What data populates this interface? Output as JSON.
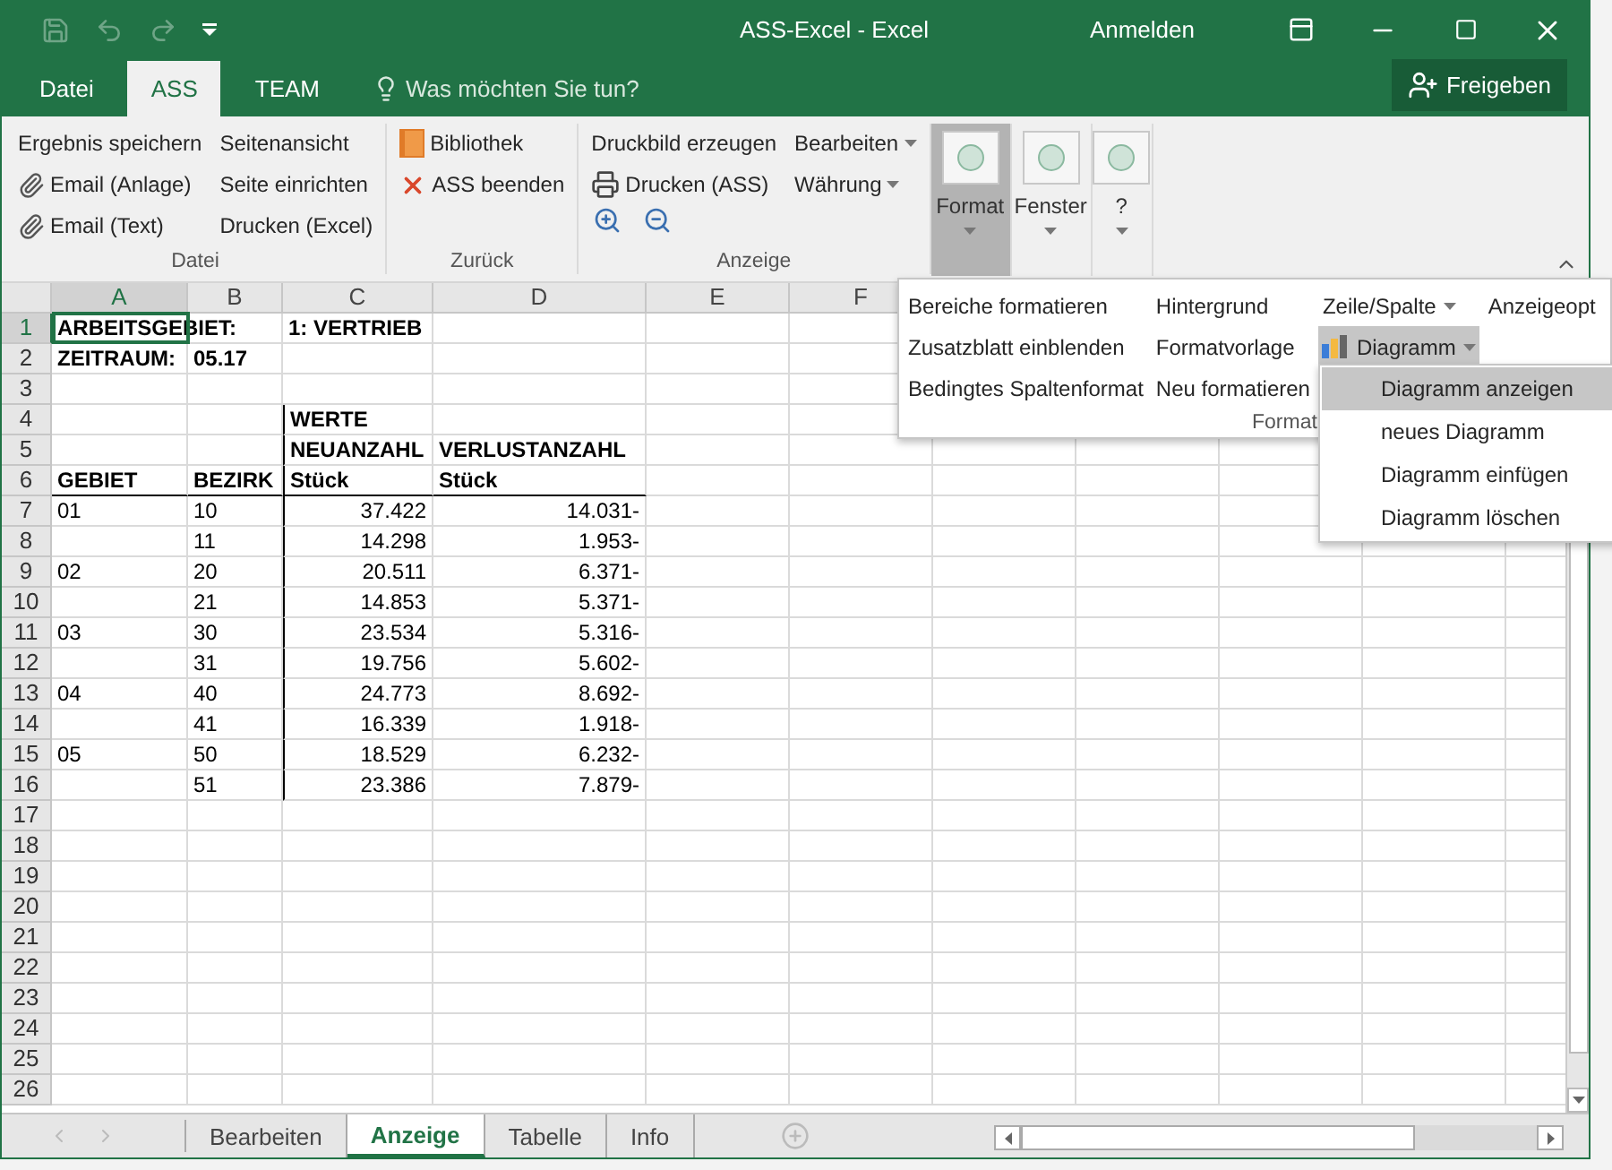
{
  "window": {
    "title": "ASS-Excel  -  Excel",
    "sign_in": "Anmelden"
  },
  "ribbon_tabs": [
    {
      "label": "Datei",
      "selected": false
    },
    {
      "label": "ASS",
      "selected": true
    },
    {
      "label": "TEAM",
      "selected": false
    }
  ],
  "tell_me": {
    "placeholder": "Was möchten Sie tun?"
  },
  "share_button": "Freigeben",
  "ribbon_groups": [
    {
      "label": "Datei",
      "columns": [
        [
          {
            "kind": "plain",
            "label": "Ergebnis speichern"
          },
          {
            "kind": "attach",
            "label": "Email (Anlage)"
          },
          {
            "kind": "attach",
            "label": "Email (Text)"
          }
        ],
        [
          {
            "kind": "plain",
            "label": "Seitenansicht"
          },
          {
            "kind": "plain",
            "label": "Seite einrichten"
          },
          {
            "kind": "plain",
            "label": "Drucken (Excel)"
          }
        ]
      ]
    },
    {
      "label": "Zurück",
      "columns": [
        [
          {
            "kind": "book",
            "label": "Bibliothek"
          },
          {
            "kind": "close",
            "label": "ASS beenden"
          }
        ]
      ]
    },
    {
      "label": "Anzeige",
      "columns": [
        [
          {
            "kind": "plain",
            "label": "Druckbild erzeugen"
          },
          {
            "kind": "print",
            "label": "Drucken (ASS)"
          },
          {
            "kind": "zoom"
          }
        ],
        [
          {
            "kind": "dropdown",
            "label": "Bearbeiten"
          },
          {
            "kind": "dropdown",
            "label": "Währung"
          }
        ]
      ]
    }
  ],
  "large_buttons": [
    {
      "label": "Format",
      "selected": true
    },
    {
      "label": "Fenster",
      "selected": false
    },
    {
      "label": "?",
      "selected": false
    }
  ],
  "format_menu": {
    "group_label": "Format",
    "columns": [
      [
        {
          "kind": "plain",
          "label": "Bereiche formatieren"
        },
        {
          "kind": "plain",
          "label": "Zusatzblatt einblenden"
        },
        {
          "kind": "plain",
          "label": "Bedingtes Spaltenformat"
        }
      ],
      [
        {
          "kind": "plain",
          "label": "Hintergrund"
        },
        {
          "kind": "plain",
          "label": "Formatvorlage"
        },
        {
          "kind": "plain",
          "label": "Neu formatieren"
        }
      ],
      [
        {
          "kind": "dropdown",
          "label": "Zeile/Spalte",
          "expanded": false
        },
        {
          "kind": "chart",
          "label": "Diagramm",
          "expanded": true
        }
      ],
      [
        {
          "kind": "plain",
          "label": "Anzeigeopt"
        }
      ]
    ]
  },
  "chart_submenu": [
    {
      "label": "Diagramm anzeigen",
      "selected": true
    },
    {
      "label": "neues Diagramm",
      "selected": false
    },
    {
      "label": "Diagramm einfügen",
      "selected": false
    },
    {
      "label": "Diagramm löschen",
      "selected": false
    }
  ],
  "sheet": {
    "columns": [
      {
        "label": "A",
        "selected": true
      },
      {
        "label": "B",
        "selected": false
      },
      {
        "label": "C",
        "selected": false
      },
      {
        "label": "D",
        "selected": false
      },
      {
        "label": "E",
        "selected": false
      },
      {
        "label": "F",
        "selected": false
      }
    ],
    "rows": [
      {
        "label": "1",
        "selected": true,
        "kind": "title",
        "a": "ARBEITSGEBIET:",
        "c": "1: VERTRIEB"
      },
      {
        "label": "2",
        "selected": false,
        "kind": "title",
        "a": "ZEITRAUM:",
        "b": "05.17"
      },
      {
        "label": "3",
        "selected": false,
        "kind": "empty"
      },
      {
        "label": "4",
        "selected": false,
        "kind": "header",
        "c": "WERTE"
      },
      {
        "label": "5",
        "selected": false,
        "kind": "header",
        "c": "NEUANZAHL",
        "d": "VERLUSTANZAHL"
      },
      {
        "label": "6",
        "selected": false,
        "kind": "header",
        "a": "GEBIET",
        "b": "BEZIRK",
        "c": "Stück",
        "d": "Stück"
      },
      {
        "label": "7",
        "selected": false,
        "kind": "data",
        "a": "01",
        "b": "10",
        "c": "37.422",
        "d": "14.031-"
      },
      {
        "label": "8",
        "selected": false,
        "kind": "data",
        "b": "11",
        "c": "14.298",
        "d": "1.953-"
      },
      {
        "label": "9",
        "selected": false,
        "kind": "data",
        "a": "02",
        "b": "20",
        "c": "20.511",
        "d": "6.371-"
      },
      {
        "label": "10",
        "selected": false,
        "kind": "data",
        "b": "21",
        "c": "14.853",
        "d": "5.371-"
      },
      {
        "label": "11",
        "selected": false,
        "kind": "data",
        "a": "03",
        "b": "30",
        "c": "23.534",
        "d": "5.316-"
      },
      {
        "label": "12",
        "selected": false,
        "kind": "data",
        "b": "31",
        "c": "19.756",
        "d": "5.602-"
      },
      {
        "label": "13",
        "selected": false,
        "kind": "data",
        "a": "04",
        "b": "40",
        "c": "24.773",
        "d": "8.692-"
      },
      {
        "label": "14",
        "selected": false,
        "kind": "data",
        "b": "41",
        "c": "16.339",
        "d": "1.918-"
      },
      {
        "label": "15",
        "selected": false,
        "kind": "data",
        "a": "05",
        "b": "50",
        "c": "18.529",
        "d": "6.232-"
      },
      {
        "label": "16",
        "selected": false,
        "kind": "data",
        "b": "51",
        "c": "23.386",
        "d": "7.879-"
      },
      {
        "label": "17",
        "selected": false,
        "kind": "empty"
      },
      {
        "label": "18",
        "selected": false,
        "kind": "empty"
      },
      {
        "label": "19",
        "selected": false,
        "kind": "empty"
      },
      {
        "label": "20",
        "selected": false,
        "kind": "empty"
      },
      {
        "label": "21",
        "selected": false,
        "kind": "empty"
      },
      {
        "label": "22",
        "selected": false,
        "kind": "empty"
      },
      {
        "label": "23",
        "selected": false,
        "kind": "empty"
      },
      {
        "label": "24",
        "selected": false,
        "kind": "empty"
      },
      {
        "label": "25",
        "selected": false,
        "kind": "empty"
      },
      {
        "label": "26",
        "selected": false,
        "kind": "empty"
      }
    ]
  },
  "sheet_tabs": [
    {
      "label": "Bearbeiten",
      "selected": false
    },
    {
      "label": "Anzeige",
      "selected": true
    },
    {
      "label": "Tabelle",
      "selected": false
    },
    {
      "label": "Info",
      "selected": false
    }
  ]
}
